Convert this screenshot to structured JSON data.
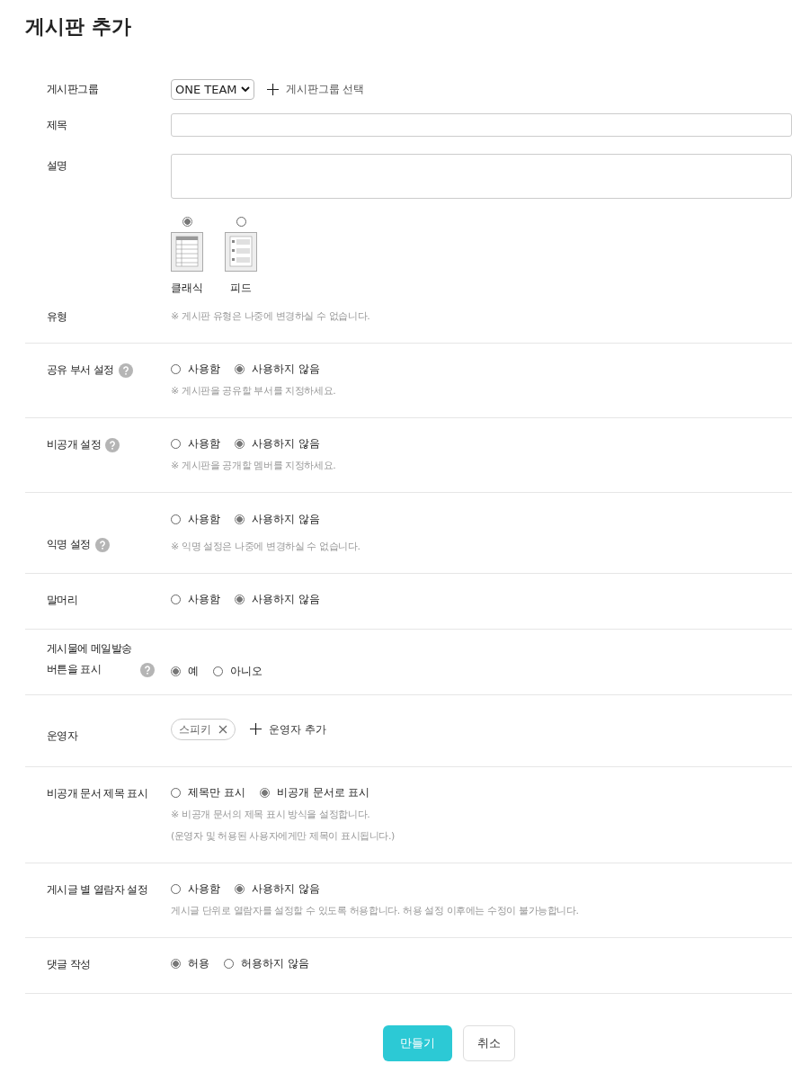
{
  "page_title": "게시판 추가",
  "board_group": {
    "label": "게시판그룹",
    "value": "ONE TEAM",
    "add_label": "게시판그룹 선택"
  },
  "title_field": {
    "label": "제목"
  },
  "description_field": {
    "label": "설명"
  },
  "board_type": {
    "label": "유형",
    "note": "※ 게시판 유형은 나중에 변경하실 수 없습니다.",
    "options": [
      {
        "label": "클래식",
        "kind": "classic",
        "selected": true
      },
      {
        "label": "피드",
        "kind": "feed",
        "selected": false
      }
    ]
  },
  "sections": [
    {
      "kind": "radio",
      "label": "공유 부서 설정",
      "help": true,
      "options": [
        {
          "label": "사용함",
          "selected": false
        },
        {
          "label": "사용하지 않음",
          "selected": true
        }
      ],
      "notes": [
        "※ 게시판을 공유할 부서를 지정하세요."
      ]
    },
    {
      "kind": "radio",
      "label": "비공개 설정",
      "help": true,
      "options": [
        {
          "label": "사용함",
          "selected": false
        },
        {
          "label": "사용하지 않음",
          "selected": true
        }
      ],
      "notes": [
        "※ 게시판을 공개할 멤버를 지정하세요."
      ]
    },
    {
      "kind": "radio",
      "label": "익명 설정",
      "help": true,
      "options": [
        {
          "label": "사용함",
          "selected": false
        },
        {
          "label": "사용하지 않음",
          "selected": true
        }
      ],
      "notes": [
        "※ 익명 설정은 나중에 변경하실 수 없습니다."
      ]
    },
    {
      "kind": "radio",
      "label": "말머리",
      "help": false,
      "options": [
        {
          "label": "사용함",
          "selected": false
        },
        {
          "label": "사용하지 않음",
          "selected": true
        }
      ]
    },
    {
      "kind": "radio",
      "label": "게시물에 메일발송 버튼을 표시",
      "help": true,
      "options": [
        {
          "label": "예",
          "selected": true
        },
        {
          "label": "아니오",
          "selected": false
        }
      ]
    },
    {
      "kind": "operators",
      "label": "운영자",
      "tags": [
        "스피키"
      ],
      "add_label": "운영자 추가"
    },
    {
      "kind": "radio",
      "label": "비공개 문서 제목 표시",
      "help": false,
      "options": [
        {
          "label": "제목만 표시",
          "selected": false
        },
        {
          "label": "비공개 문서로 표시",
          "selected": true
        }
      ],
      "notes": [
        "※ 비공개 문서의 제목 표시 방식을 설정합니다.",
        "(운영자 및 허용된 사용자에게만 제목이 표시됩니다.)"
      ]
    },
    {
      "kind": "radio",
      "label": "게시글 별 열람자 설정",
      "help": false,
      "options": [
        {
          "label": "사용함",
          "selected": false
        },
        {
          "label": "사용하지 않음",
          "selected": true
        }
      ],
      "notes": [
        "게시글 단위로 열람자를 설정할 수 있도록 허용합니다. 허용 설정 이후에는 수정이 불가능합니다."
      ]
    },
    {
      "kind": "radio",
      "label": "댓글 작성",
      "help": false,
      "options": [
        {
          "label": "허용",
          "selected": true
        },
        {
          "label": "허용하지 않음",
          "selected": false
        }
      ]
    }
  ],
  "buttons": [
    {
      "label": "만들기",
      "kind": "primary"
    },
    {
      "label": "취소",
      "kind": "secondary"
    }
  ]
}
